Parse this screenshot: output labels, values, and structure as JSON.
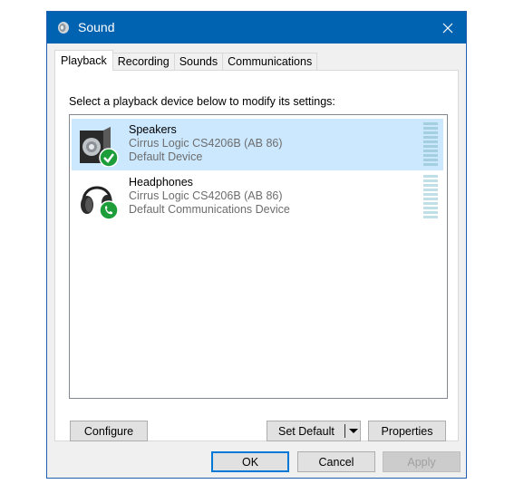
{
  "window": {
    "title": "Sound",
    "title_icon": "speaker-icon",
    "close_icon": "close-icon",
    "accent_color": "#0063b1"
  },
  "tabs": [
    {
      "label": "Playback",
      "active": true
    },
    {
      "label": "Recording",
      "active": false
    },
    {
      "label": "Sounds",
      "active": false
    },
    {
      "label": "Communications",
      "active": false
    }
  ],
  "playback": {
    "instruction": "Select a playback device below to modify its settings:",
    "devices": [
      {
        "name": "Speakers",
        "driver": "Cirrus Logic CS4206B (AB 86)",
        "status": "Default Device",
        "icon": "speaker-icon",
        "badge": "checkmark-badge-icon",
        "selected": true,
        "level_segments": 10
      },
      {
        "name": "Headphones",
        "driver": "Cirrus Logic CS4206B (AB 86)",
        "status": "Default Communications Device",
        "icon": "headphones-icon",
        "badge": "phone-badge-icon",
        "selected": false,
        "level_segments": 10
      }
    ],
    "buttons": {
      "configure": "Configure",
      "set_default": "Set Default",
      "properties": "Properties"
    }
  },
  "footer": {
    "ok": "OK",
    "cancel": "Cancel",
    "apply": "Apply"
  }
}
